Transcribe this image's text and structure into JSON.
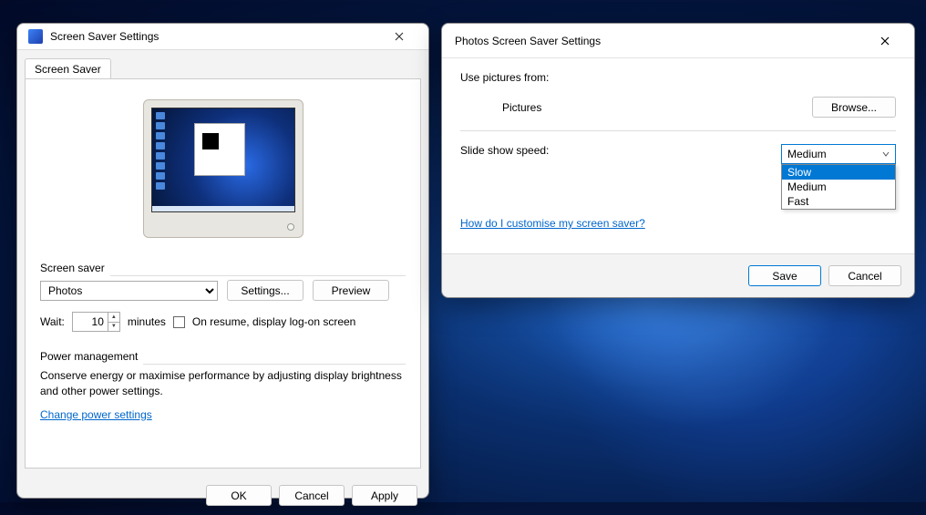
{
  "left": {
    "title": "Screen Saver Settings",
    "tab_label": "Screen Saver",
    "group_saver": "Screen saver",
    "saver_options": [
      "Photos"
    ],
    "saver_selected": "Photos",
    "settings_btn": "Settings...",
    "preview_btn": "Preview",
    "wait_label": "Wait:",
    "wait_value": "10",
    "minutes_label": "minutes",
    "resume_label": "On resume, display log-on screen",
    "group_power": "Power management",
    "power_text": "Conserve energy or maximise performance by adjusting display brightness and other power settings.",
    "power_link": "Change power settings",
    "ok": "OK",
    "cancel": "Cancel",
    "apply": "Apply"
  },
  "right": {
    "title": "Photos Screen Saver Settings",
    "use_from": "Use pictures from:",
    "pictures": "Pictures",
    "browse": "Browse...",
    "speed_label": "Slide show speed:",
    "speed_selected": "Medium",
    "speed_options": [
      "Slow",
      "Medium",
      "Fast"
    ],
    "speed_highlight": "Slow",
    "help": "How do I customise my screen saver?",
    "save": "Save",
    "cancel": "Cancel"
  }
}
